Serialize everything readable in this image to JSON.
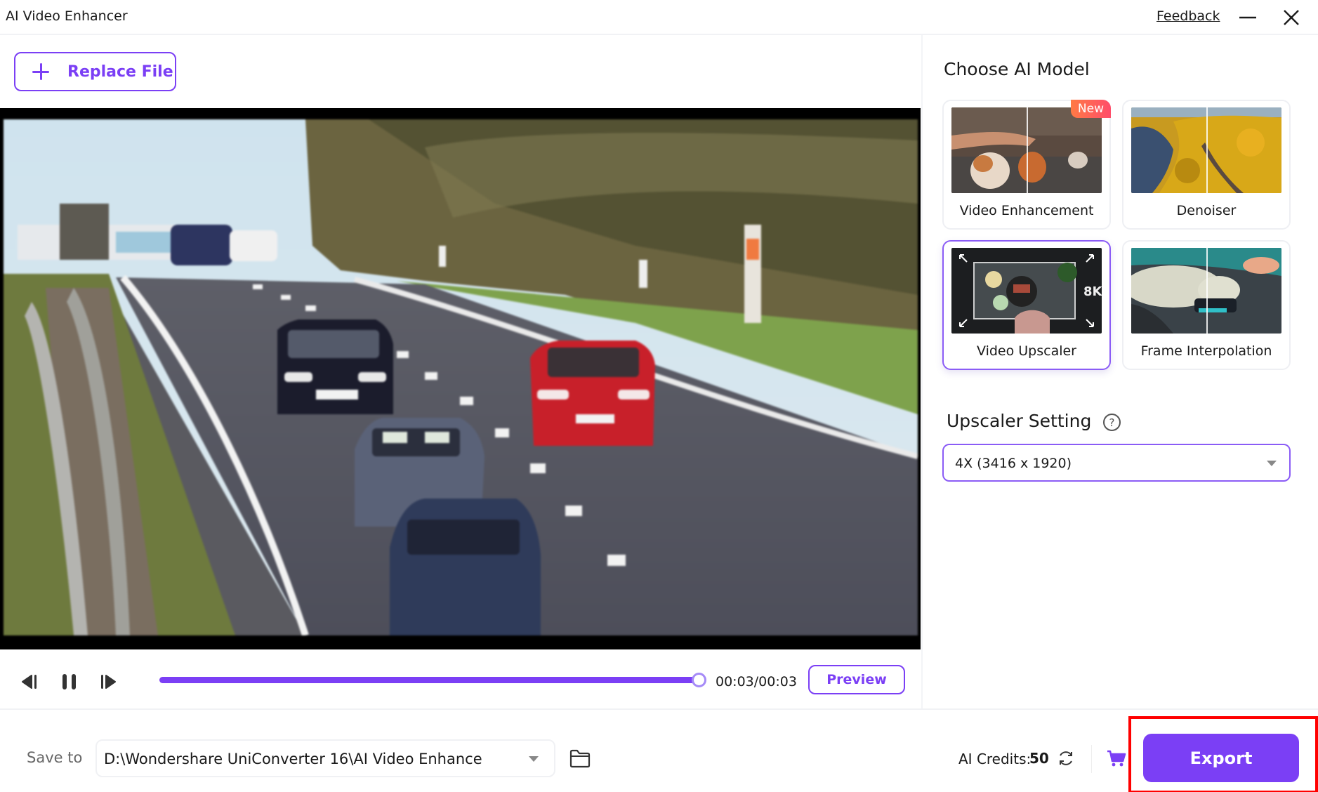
{
  "window": {
    "title": "AI Video Enhancer",
    "feedback_label": "Feedback",
    "minimize_icon": "minimize-icon",
    "close_icon": "close-icon"
  },
  "left_panel": {
    "replace_file_label": "Replace File",
    "player": {
      "current_time": "00:03",
      "duration": "00:03",
      "time_display": "00:03/00:03",
      "progress_fraction": 1.0,
      "preview_label": "Preview",
      "controls": [
        "previous-frame-icon",
        "pause-icon",
        "next-frame-icon"
      ]
    }
  },
  "right_panel": {
    "title": "Choose AI Model",
    "models": [
      {
        "name": "Video Enhancement",
        "badge": "New",
        "selected": false
      },
      {
        "name": "Denoiser",
        "badge": null,
        "selected": false
      },
      {
        "name": "Video Upscaler",
        "badge": null,
        "selected": true,
        "thumb_label": "8K"
      },
      {
        "name": "Frame Interpolation",
        "badge": null,
        "selected": false
      }
    ],
    "setting_title": "Upscaler Setting",
    "help_glyph": "?",
    "upscale_option": "4X (3416 x 1920)"
  },
  "bottom_bar": {
    "save_to_label": "Save to",
    "save_path": "D:\\Wondershare UniConverter 16\\AI Video Enhance",
    "credits_label": "AI Credits:",
    "credits_value": "50",
    "export_label": "Export"
  },
  "colors": {
    "accent": "#7b3ff5",
    "highlight": "#ff0000",
    "badge_new": "#ff5f5a"
  }
}
